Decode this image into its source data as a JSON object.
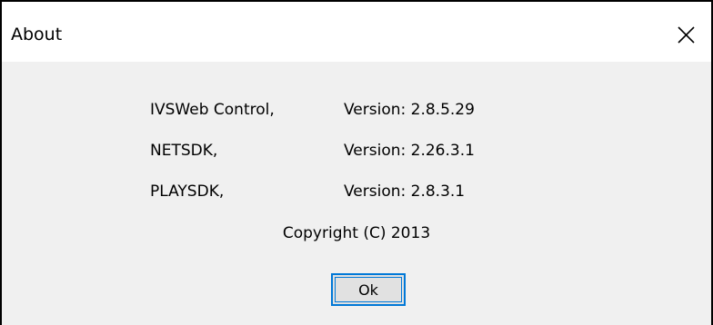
{
  "window": {
    "title": "About"
  },
  "info": {
    "rows": [
      {
        "name": "IVSWeb Control,",
        "version": "Version: 2.8.5.29"
      },
      {
        "name": "NETSDK,",
        "version": "Version: 2.26.3.1"
      },
      {
        "name": "PLAYSDK,",
        "version": "Version: 2.8.3.1"
      }
    ],
    "copyright": "Copyright (C) 2013"
  },
  "buttons": {
    "ok_label": "Ok"
  },
  "icons": {
    "close": "close-icon"
  },
  "colors": {
    "titlebar_bg": "#ffffff",
    "client_bg": "#f0f0f0",
    "focus_border": "#0078d7"
  }
}
